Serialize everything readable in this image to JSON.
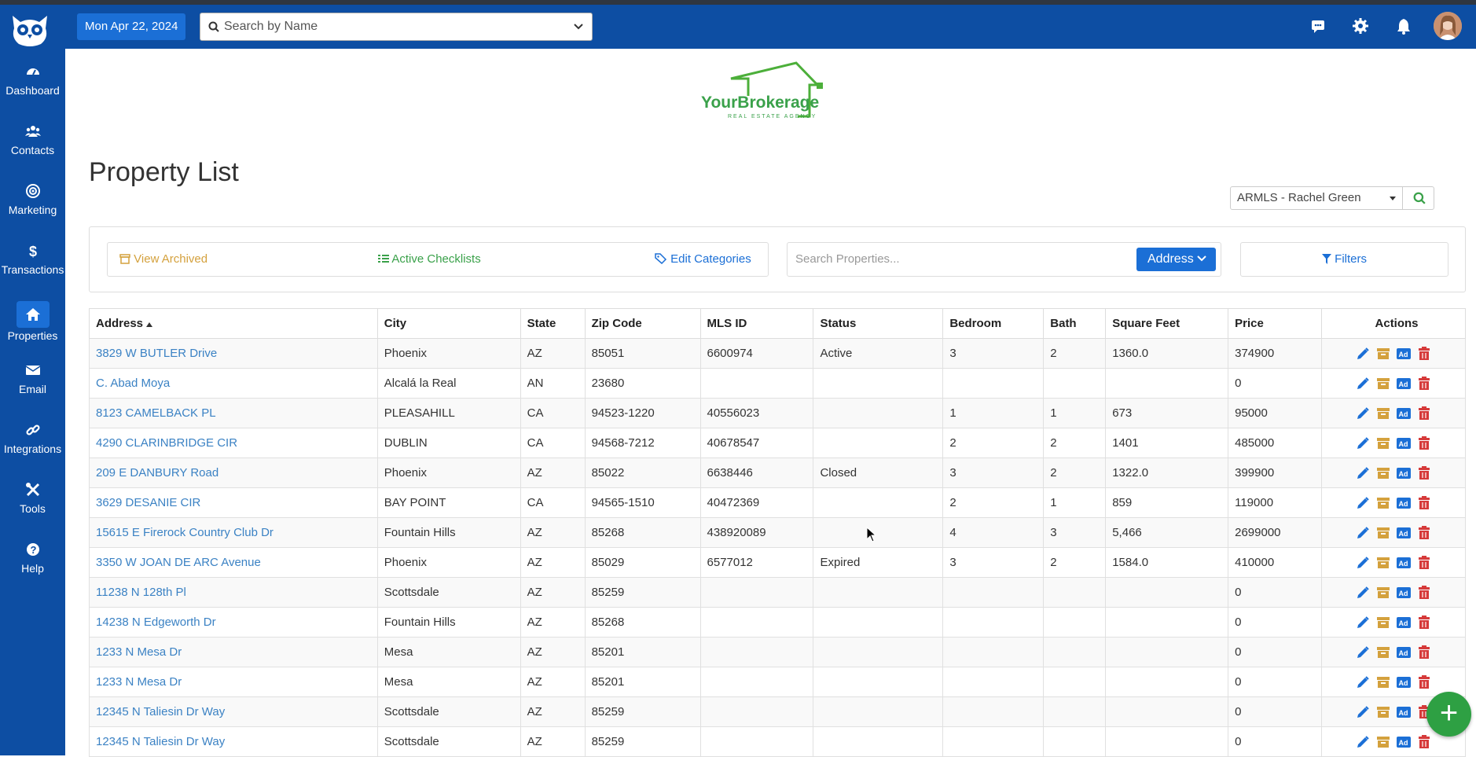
{
  "header": {
    "date": "Mon Apr 22, 2024",
    "search_placeholder": "Search by Name"
  },
  "sidebar": {
    "items": [
      {
        "label": "Dashboard",
        "icon": "dashboard-icon"
      },
      {
        "label": "Contacts",
        "icon": "users-icon"
      },
      {
        "label": "Marketing",
        "icon": "bullseye-icon"
      },
      {
        "label": "Transactions",
        "icon": "dollar-icon"
      },
      {
        "label": "Properties",
        "icon": "home-icon",
        "active": true
      },
      {
        "label": "Email",
        "icon": "envelope-icon"
      },
      {
        "label": "Integrations",
        "icon": "link-icon"
      },
      {
        "label": "Tools",
        "icon": "tools-icon"
      },
      {
        "label": "Help",
        "icon": "help-icon"
      }
    ]
  },
  "brand": {
    "name": "YourBrokerage",
    "tagline": "REAL ESTATE AGENCY"
  },
  "page": {
    "title": "Property List"
  },
  "mls_select": {
    "value": "ARMLS - Rachel Green"
  },
  "toolbar": {
    "view_archived": "View Archived",
    "active_checklists": "Active Checklists",
    "edit_categories": "Edit Categories",
    "search_placeholder": "Search Properties...",
    "search_field": "Address",
    "filters": "Filters"
  },
  "table": {
    "columns": [
      "Address",
      "City",
      "State",
      "Zip Code",
      "MLS ID",
      "Status",
      "Bedroom",
      "Bath",
      "Square Feet",
      "Price",
      "Actions"
    ],
    "rows": [
      [
        "3829 W BUTLER Drive",
        "Phoenix",
        "AZ",
        "85051",
        "6600974",
        "Active",
        "3",
        "2",
        "1360.0",
        "374900"
      ],
      [
        "C. Abad Moya",
        "Alcalá la Real",
        "AN",
        "23680",
        "",
        "",
        "",
        "",
        "",
        "0"
      ],
      [
        "8123 CAMELBACK PL",
        "PLEASAHILL",
        "CA",
        "94523-1220",
        "40556023",
        "",
        "1",
        "1",
        "673",
        "95000"
      ],
      [
        "4290 CLARINBRIDGE CIR",
        "DUBLIN",
        "CA",
        "94568-7212",
        "40678547",
        "",
        "2",
        "2",
        "1401",
        "485000"
      ],
      [
        "209 E DANBURY Road",
        "Phoenix",
        "AZ",
        "85022",
        "6638446",
        "Closed",
        "3",
        "2",
        "1322.0",
        "399900"
      ],
      [
        "3629 DESANIE CIR",
        "BAY POINT",
        "CA",
        "94565-1510",
        "40472369",
        "",
        "2",
        "1",
        "859",
        "119000"
      ],
      [
        "15615 E Firerock Country Club Dr",
        "Fountain Hills",
        "AZ",
        "85268",
        "438920089",
        "",
        "4",
        "3",
        "5,466",
        "2699000"
      ],
      [
        "3350 W JOAN DE ARC Avenue",
        "Phoenix",
        "AZ",
        "85029",
        "6577012",
        "Expired",
        "3",
        "2",
        "1584.0",
        "410000"
      ],
      [
        "11238 N 128th Pl",
        "Scottsdale",
        "AZ",
        "85259",
        "",
        "",
        "",
        "",
        "",
        "0"
      ],
      [
        "14238 N Edgeworth Dr",
        "Fountain Hills",
        "AZ",
        "85268",
        "",
        "",
        "",
        "",
        "",
        "0"
      ],
      [
        "1233 N Mesa Dr",
        "Mesa",
        "AZ",
        "85201",
        "",
        "",
        "",
        "",
        "",
        "0"
      ],
      [
        "1233 N Mesa Dr",
        "Mesa",
        "AZ",
        "85201",
        "",
        "",
        "",
        "",
        "",
        "0"
      ],
      [
        "12345 N Taliesin Dr Way",
        "Scottsdale",
        "AZ",
        "85259",
        "",
        "",
        "",
        "",
        "",
        "0"
      ],
      [
        "12345 N Taliesin Dr Way",
        "Scottsdale",
        "AZ",
        "85259",
        "",
        "",
        "",
        "",
        "",
        "0"
      ]
    ]
  },
  "colors": {
    "primary": "#0d4ea3",
    "accent": "#1b6fd6",
    "link": "#3b82c4",
    "archive": "#d4a13d",
    "delete": "#d63a3a",
    "checklist": "#3aa14a"
  },
  "fab": {
    "label": "+"
  }
}
